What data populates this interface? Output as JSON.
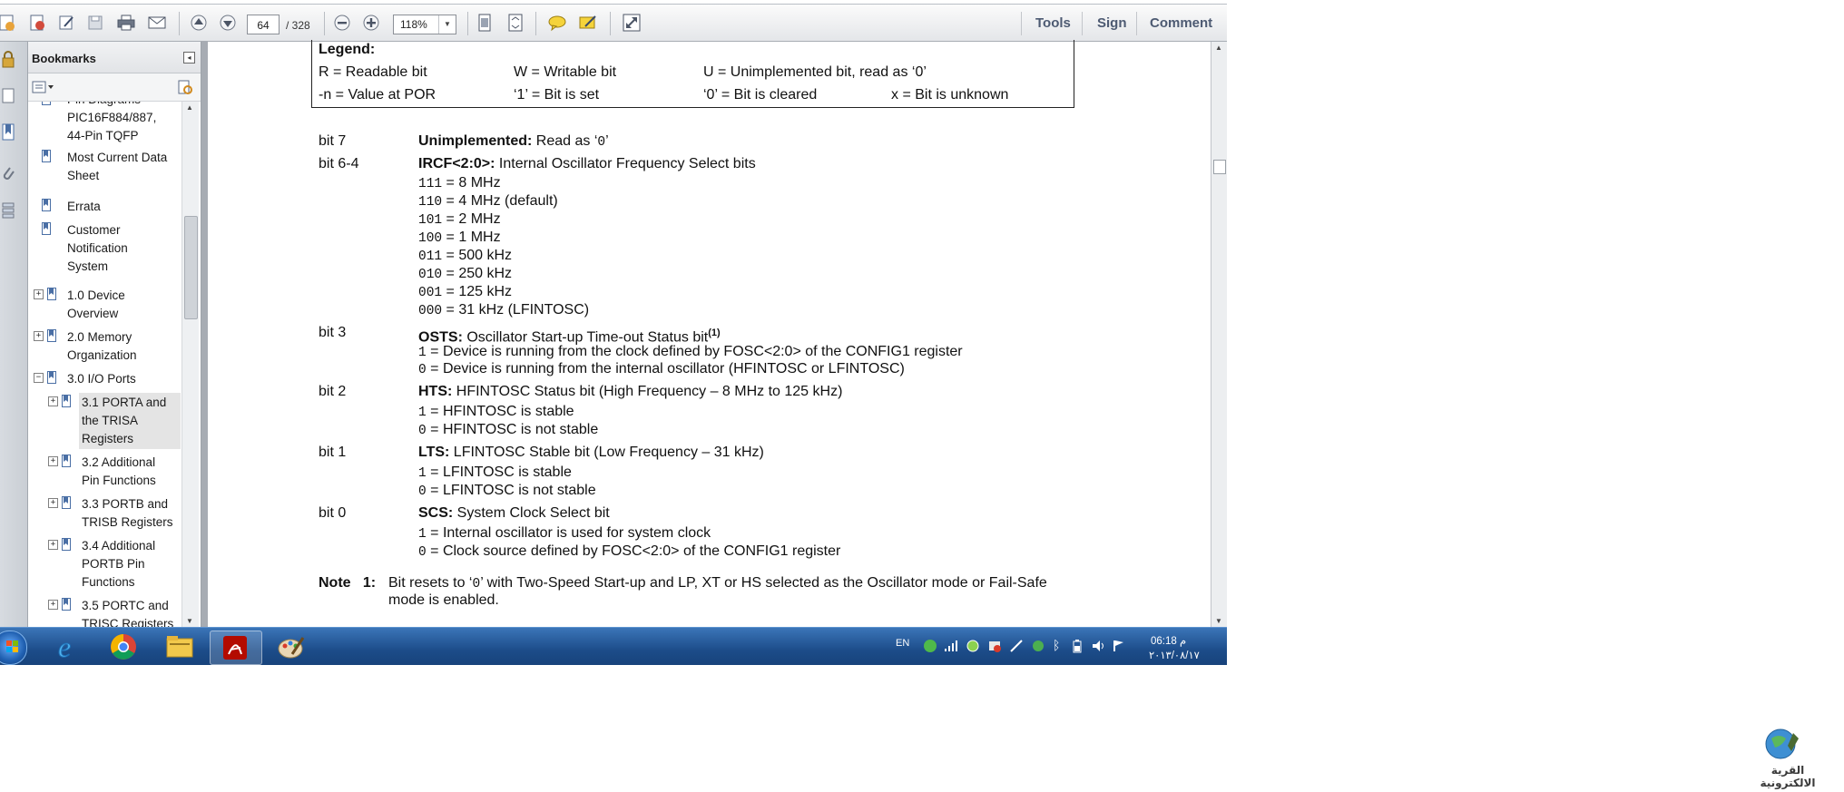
{
  "toolbar": {
    "page_current": "64",
    "page_total": "/ 328",
    "zoom": "118%",
    "tools_label": "Tools",
    "sign_label": "Sign",
    "comment_label": "Comment"
  },
  "bookmarks": {
    "title": "Bookmarks",
    "items": [
      {
        "label": "Pin Diagrams –",
        "label2": "PIC16F884/887,",
        "label3": "44-Pin TQFP"
      },
      {
        "label": "Most Current Data",
        "label2": "Sheet"
      },
      {
        "label": "Errata"
      },
      {
        "label": "Customer",
        "label2": "Notification",
        "label3": "System"
      },
      {
        "label": "1.0 Device",
        "label2": "Overview"
      },
      {
        "label": "2.0 Memory",
        "label2": "Organization"
      },
      {
        "label": "3.0 I/O Ports"
      },
      {
        "label": "3.1 PORTA and",
        "label2": "the TRISA",
        "label3": "Registers"
      },
      {
        "label": "3.2 Additional",
        "label2": "Pin Functions"
      },
      {
        "label": "3.3 PORTB and",
        "label2": "TRISB Registers"
      },
      {
        "label": "3.4 Additional",
        "label2": "PORTB Pin",
        "label3": "Functions"
      },
      {
        "label": "3.5 PORTC and",
        "label2": "TRISC Registers"
      }
    ]
  },
  "document": {
    "legend": {
      "title": "Legend:",
      "r": "R = Readable bit",
      "w": "W = Writable bit",
      "u": "U = Unimplemented bit, read as ‘0’",
      "n": "-n = Value at POR",
      "set": "‘1’ = Bit is set",
      "cleared": "‘0’ = Bit is cleared",
      "unknown": "x = Bit is unknown"
    },
    "bit7": {
      "label": "bit 7",
      "name": "Unimplemented:",
      "desc": " Read as ‘",
      "zero": "0",
      "end": "’"
    },
    "bit64": {
      "label": "bit 6-4",
      "name": "IRCF<2:0>:",
      "desc": " Internal Oscillator Frequency Select bits",
      "options": [
        {
          "code": "111",
          "text": " = 8 MHz"
        },
        {
          "code": "110",
          "text": " = 4 MHz (default)"
        },
        {
          "code": "101",
          "text": " = 2 MHz"
        },
        {
          "code": "100",
          "text": " = 1 MHz"
        },
        {
          "code": "011",
          "text": " = 500 kHz"
        },
        {
          "code": "010",
          "text": " = 250 kHz"
        },
        {
          "code": "001",
          "text": " = 125 kHz"
        },
        {
          "code": "000",
          "text": " = 31 kHz (LFINTOSC)"
        }
      ]
    },
    "bit3": {
      "label": "bit 3",
      "name": "OSTS:",
      "desc": " Oscillator Start-up Time-out Status bit",
      "sup": "(1)",
      "options": [
        {
          "code": "1",
          "text": " =  Device is running from the clock defined by FOSC<2:0> of the CONFIG1 register"
        },
        {
          "code": "0",
          "text": " =  Device is running from the internal oscillator (HFINTOSC or LFINTOSC)"
        }
      ]
    },
    "bit2": {
      "label": "bit 2",
      "name": "HTS:",
      "desc": " HFINTOSC Status bit (High Frequency – 8 MHz to 125 kHz)",
      "options": [
        {
          "code": "1",
          "text": " =  HFINTOSC is stable"
        },
        {
          "code": "0",
          "text": " =  HFINTOSC is not stable"
        }
      ]
    },
    "bit1": {
      "label": "bit 1",
      "name": "LTS:",
      "desc": " LFINTOSC Stable bit (Low Frequency – 31 kHz)",
      "options": [
        {
          "code": "1",
          "text": " =  LFINTOSC is stable"
        },
        {
          "code": "0",
          "text": " =  LFINTOSC is not stable"
        }
      ]
    },
    "bit0": {
      "label": "bit 0",
      "name": "SCS:",
      "desc": " System Clock Select bit",
      "options": [
        {
          "code": "1",
          "text": " =  Internal oscillator is used for system clock"
        },
        {
          "code": "0",
          "text": " =  Clock source defined by FOSC<2:0> of the CONFIG1 register"
        }
      ]
    },
    "note": {
      "label": "Note   1:",
      "line1_a": "Bit resets to ‘",
      "line1_zero": "0",
      "line1_b": "’ with Two-Speed Start-up and LP, XT or HS selected as the Oscillator mode or Fail-Safe",
      "line2": "mode is enabled."
    }
  },
  "taskbar": {
    "lang": "EN",
    "time": "06:18 م",
    "date": "٢٠١٣/٠٨/١٧"
  },
  "watermark": {
    "text": "القرية الالكترونية"
  },
  "colors": {
    "taskbar": "#1c4c89",
    "accent": "#4d5a72",
    "doc_bg": "#a7acb3"
  }
}
